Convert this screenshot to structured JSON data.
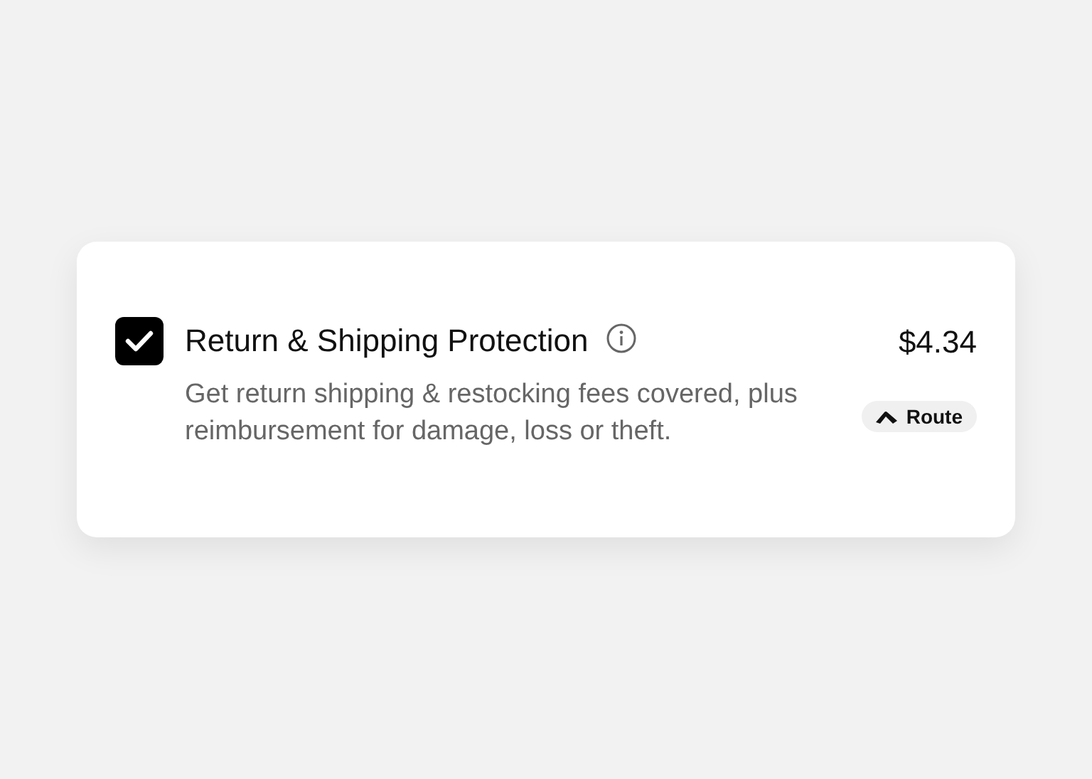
{
  "option": {
    "checked": true,
    "title": "Return & Shipping Protection",
    "description": "Get return shipping & restocking fees covered, plus reimbursement for damage, loss or theft.",
    "price": "$4.34",
    "badge": "Route"
  }
}
